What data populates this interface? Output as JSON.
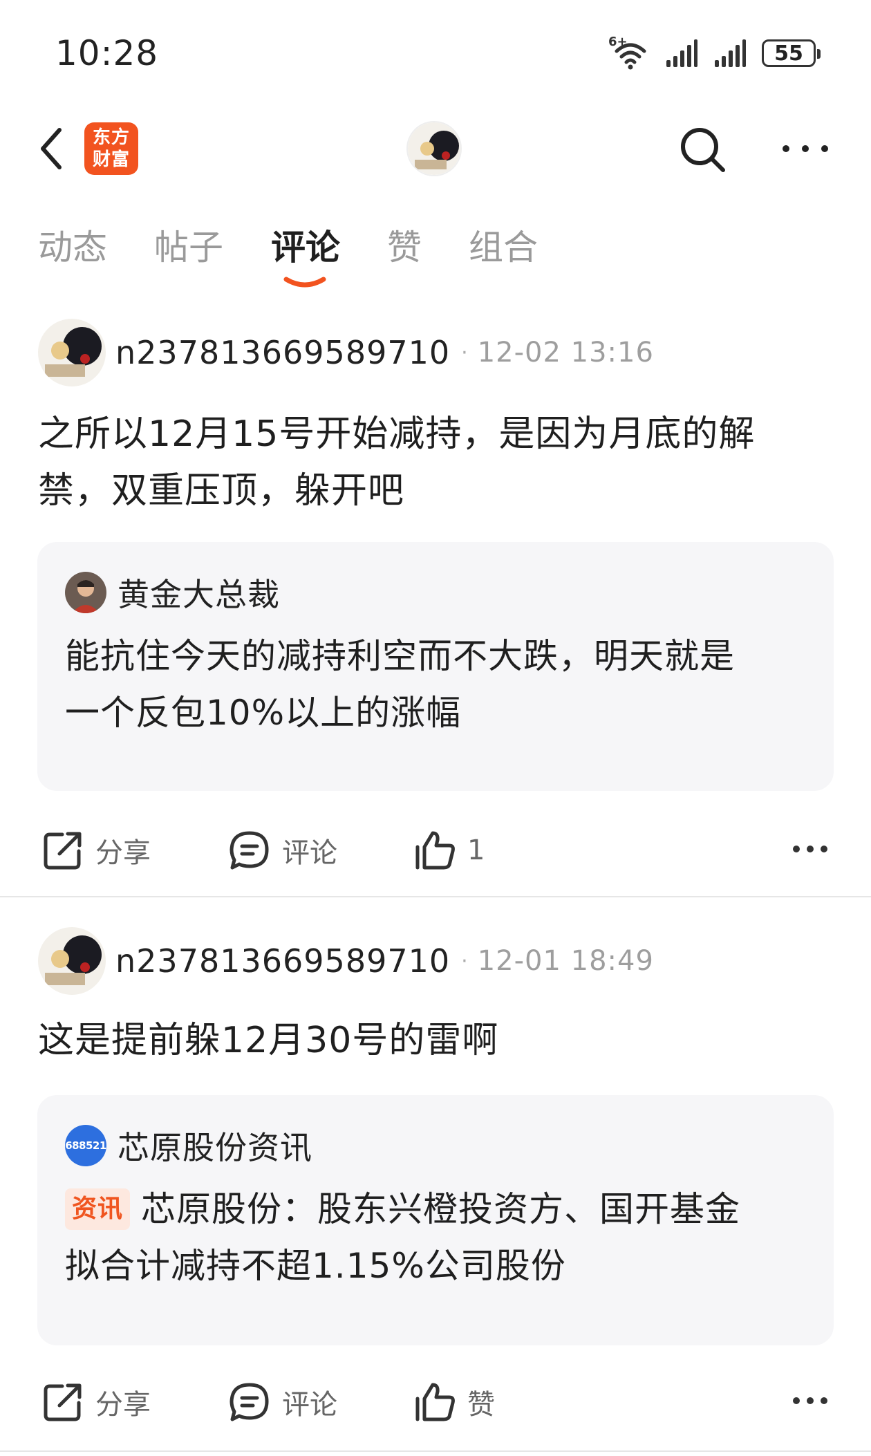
{
  "status_bar": {
    "time": "10:28",
    "network_label": "6+",
    "battery": "55",
    "icons": [
      "wifi-icon",
      "signal-icon",
      "signal-icon",
      "battery-icon"
    ]
  },
  "nav": {
    "brand_line1": "东方",
    "brand_line2": "财富",
    "icons": [
      "back-icon",
      "avatar",
      "search-icon",
      "more-icon"
    ]
  },
  "tabs": [
    {
      "label": "动态",
      "active": false
    },
    {
      "label": "帖子",
      "active": false
    },
    {
      "label": "评论",
      "active": true
    },
    {
      "label": "赞",
      "active": false
    },
    {
      "label": "组合",
      "active": false
    }
  ],
  "accent_color": "#f2531f",
  "posts": [
    {
      "username": "n237813669589710",
      "time": "12-02 13:16",
      "body_line1": "之所以12月15号开始减持，是因为月底的解",
      "body_line2": "禁，双重压顶，躲开吧",
      "quote": {
        "author": "黄金大总裁",
        "text_line1": "能抗住今天的减持利空而不大跌，明天就是",
        "text_line2": "一个反包10%以上的涨幅"
      },
      "actions": {
        "share": "分享",
        "comment": "评论",
        "like": "1"
      }
    },
    {
      "username": "n237813669589710",
      "time": "12-01 18:49",
      "body_line1": "这是提前躲12月30号的雷啊",
      "quote": {
        "author_badge": "688521",
        "author": "芯原股份资讯",
        "tag": "资讯",
        "text_line1": "芯原股份：股东兴橙投资方、国开基金",
        "text_line2": "拟合计减持不超1.15%公司股份"
      },
      "actions": {
        "share": "分享",
        "comment": "评论",
        "like": "赞"
      }
    }
  ]
}
